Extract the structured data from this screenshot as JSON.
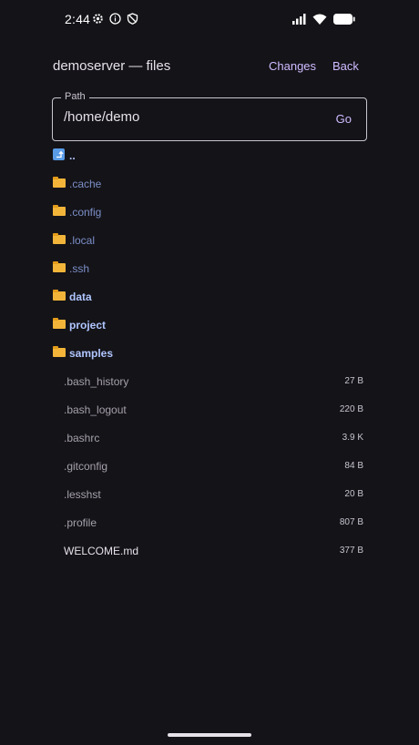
{
  "status_bar": {
    "time": "2:44",
    "left_icons": [
      "settings-gear-icon",
      "info-icon",
      "shield-icon"
    ],
    "right_icons": [
      "cell-signal-icon",
      "wifi-icon",
      "battery-icon"
    ]
  },
  "app_bar": {
    "title": "demoserver — files",
    "changes_label": "Changes",
    "back_label": "Back"
  },
  "path_field": {
    "label": "Path",
    "value": "/home/demo",
    "go_label": "Go"
  },
  "entries": [
    {
      "kind": "up",
      "name": "..",
      "size": ""
    },
    {
      "kind": "dir-hidden",
      "name": ".cache",
      "size": ""
    },
    {
      "kind": "dir-hidden",
      "name": ".config",
      "size": ""
    },
    {
      "kind": "dir-hidden",
      "name": ".local",
      "size": ""
    },
    {
      "kind": "dir-hidden",
      "name": ".ssh",
      "size": ""
    },
    {
      "kind": "dir",
      "name": "data",
      "size": ""
    },
    {
      "kind": "dir",
      "name": "project",
      "size": ""
    },
    {
      "kind": "dir",
      "name": "samples",
      "size": ""
    },
    {
      "kind": "file-hidden",
      "name": ".bash_history",
      "size": "27 B"
    },
    {
      "kind": "file-hidden",
      "name": ".bash_logout",
      "size": "220 B"
    },
    {
      "kind": "file-hidden",
      "name": ".bashrc",
      "size": "3.9 K"
    },
    {
      "kind": "file-hidden",
      "name": ".gitconfig",
      "size": "84 B"
    },
    {
      "kind": "file-hidden",
      "name": ".lesshst",
      "size": "20 B"
    },
    {
      "kind": "file-hidden",
      "name": ".profile",
      "size": "807 B"
    },
    {
      "kind": "file",
      "name": "WELCOME.md",
      "size": "377 B"
    }
  ],
  "colors": {
    "background": "#141318",
    "accent": "#cfbcff",
    "directory": "#b0c6ff",
    "hidden_directory": "#7b8fc7"
  }
}
